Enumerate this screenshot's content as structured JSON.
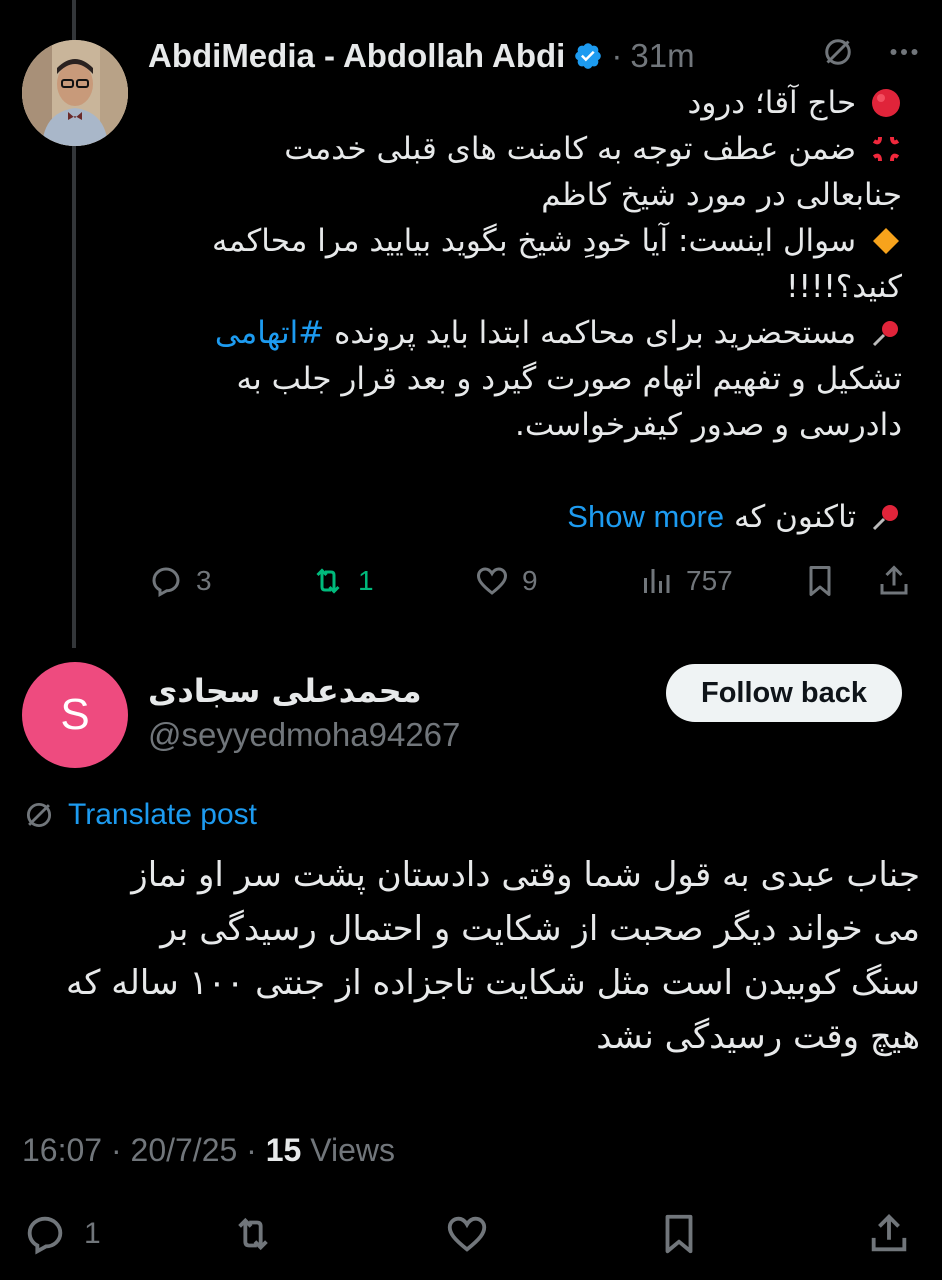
{
  "tweet": {
    "author_name": "AbdiMedia - Abdollah Abdi",
    "time": "31m",
    "lines": [
      {
        "emoji": "red-circle",
        "text": "حاج آقا؛ درود"
      },
      {
        "emoji": "anger-symbol",
        "text": "ضمن عطف توجه به کامنت های قبلی خدمت"
      },
      {
        "emoji": "",
        "text": "جنابعالی در مورد شیخ کاظم"
      },
      {
        "emoji": "orange-diamond",
        "text": "سوال اینست: آیا خودِ شیخ بگوید بیایید مرا محاکمه"
      },
      {
        "emoji": "",
        "text": "کنید؟!!!!"
      },
      {
        "emoji": "pushpin",
        "text": "مستحضرید برای محاکمه ابتدا باید پرونده",
        "hashtag": "#اتهامی"
      },
      {
        "emoji": "",
        "text": "تشکیل و تفهیم اتهام صورت گیرد و بعد قرار جلب به"
      },
      {
        "emoji": "",
        "text": "دادرسی و صدور کیفرخواست."
      }
    ],
    "last_line": {
      "emoji": "pushpin",
      "text": "تاکنون که"
    },
    "show_more": "Show more",
    "stats": {
      "replies": "3",
      "reposts": "1",
      "likes": "9",
      "views": "757"
    }
  },
  "reply": {
    "avatar_letter": "S",
    "name": "محمدعلی سجادی",
    "handle": "@seyyedmoha94267",
    "follow_label": "Follow back",
    "translate_label": "Translate post",
    "lines": [
      "جناب عبدی به قول شما وقتی دادستان پشت سر او نماز",
      "می خواند دیگر صحبت از شکایت و احتمال رسیدگی بر",
      "سنگ کوبیدن است مثل شکایت تاجزاده از جنتی ۱۰۰ ساله که",
      "هیچ وقت رسیدگی نشد"
    ],
    "meta_time": "16:07",
    "meta_date": "20/7/25",
    "meta_views_count": "15",
    "meta_views_label": "Views",
    "stats": {
      "replies": "1"
    }
  },
  "colors": {
    "background": "#000000",
    "accent": "#1d9bf0",
    "repost_active": "#00ba7c",
    "avatar_pink": "#ee4b7f"
  },
  "icons": [
    "verified-badge-icon",
    "grok-icon",
    "more-icon",
    "reply-icon",
    "repost-icon",
    "like-icon",
    "views-icon",
    "bookmark-icon",
    "share-icon",
    "translate-icon"
  ]
}
